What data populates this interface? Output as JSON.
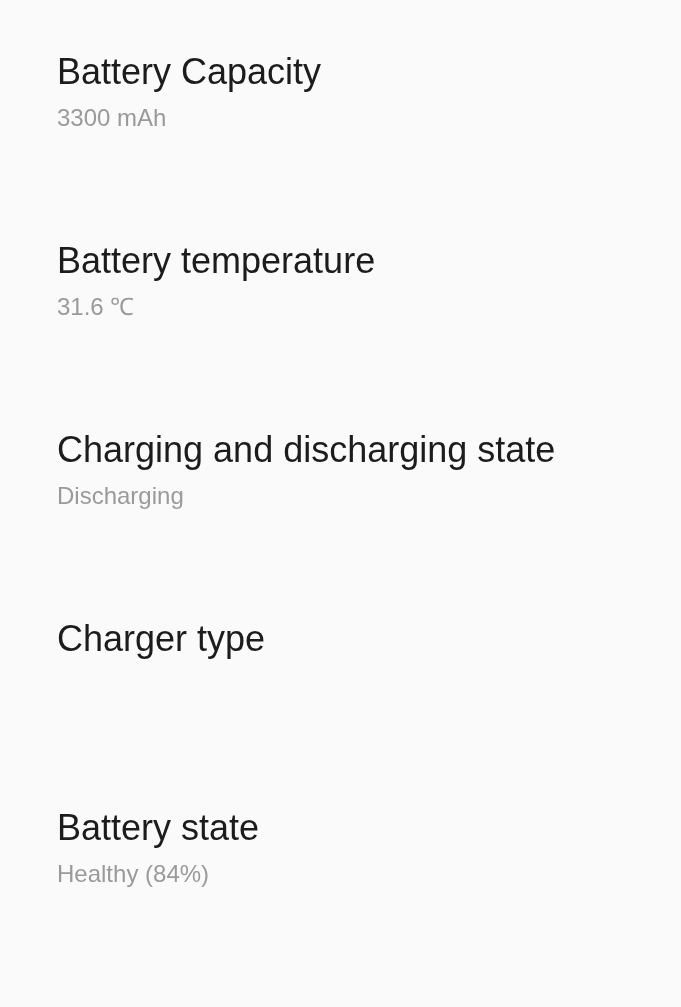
{
  "items": [
    {
      "title": "Battery Capacity",
      "value": "3300 mAh"
    },
    {
      "title": "Battery temperature",
      "value": "31.6 ℃"
    },
    {
      "title": "Charging and discharging state",
      "value": "Discharging"
    },
    {
      "title": "Charger type"
    },
    {
      "title": "Battery state",
      "value": "Healthy (84%)"
    }
  ]
}
